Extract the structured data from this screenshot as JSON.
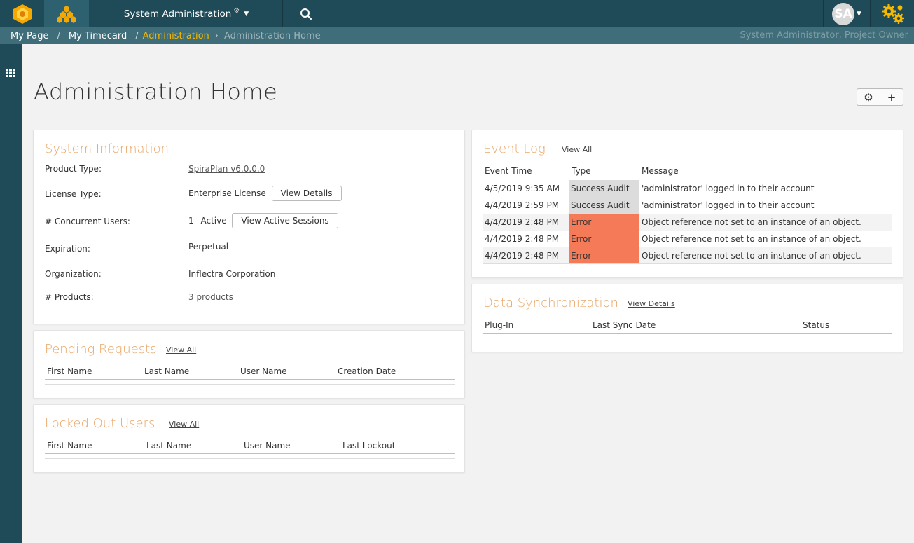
{
  "header": {
    "menu_title": "System Administration",
    "user_initials": "SA"
  },
  "breadcrumb": {
    "items": [
      "My Page",
      "My Timecard"
    ],
    "active": "Administration",
    "current": "Administration Home",
    "role": "System Administrator, Project Owner"
  },
  "page": {
    "title": "Administration Home"
  },
  "system_info": {
    "title": "System Information",
    "product_type_label": "Product Type:",
    "product_type_value": "SpiraPlan v6.0.0.0",
    "license_type_label": "License Type:",
    "license_type_value": "Enterprise License",
    "view_details_button": "View Details",
    "users_label": "# Concurrent Users:",
    "users_value": "1",
    "users_active": "Active",
    "view_sessions_button": "View Active Sessions",
    "expiration_label": "Expiration:",
    "expiration_value": "Perpetual",
    "organization_label": "Organization:",
    "organization_value": "Inflectra Corporation",
    "products_label": "# Products:",
    "products_value": "3 products"
  },
  "pending_requests": {
    "title": "Pending Requests",
    "view_all": "View All",
    "columns": [
      "First Name",
      "Last Name",
      "User Name",
      "Creation Date"
    ]
  },
  "locked_users": {
    "title": "Locked Out Users",
    "view_all": "View All",
    "columns": [
      "First Name",
      "Last Name",
      "User Name",
      "Last Lockout"
    ]
  },
  "event_log": {
    "title": "Event Log",
    "view_all": "View All",
    "columns": [
      "Event Time",
      "Type",
      "Message"
    ],
    "rows": [
      {
        "time": "4/5/2019 9:35 AM",
        "type": "Success Audit",
        "message": "'administrator' logged in to their account"
      },
      {
        "time": "4/4/2019 2:59 PM",
        "type": "Success Audit",
        "message": "'administrator' logged in to their account"
      },
      {
        "time": "4/4/2019 2:48 PM",
        "type": "Error",
        "message": "Object reference not set to an instance of an object."
      },
      {
        "time": "4/4/2019 2:48 PM",
        "type": "Error",
        "message": "Object reference not set to an instance of an object."
      },
      {
        "time": "4/4/2019 2:48 PM",
        "type": "Error",
        "message": "Object reference not set to an instance of an object."
      }
    ]
  },
  "data_sync": {
    "title": "Data Synchronization",
    "view_details": "View Details",
    "columns": [
      "Plug-In",
      "Last Sync Date",
      "Status"
    ]
  },
  "colors": {
    "topbar": "#1f4a57",
    "accent": "#f6b900",
    "panel_title": "#e8a667",
    "error": "#f47a58",
    "audit": "#dcdcdc"
  }
}
